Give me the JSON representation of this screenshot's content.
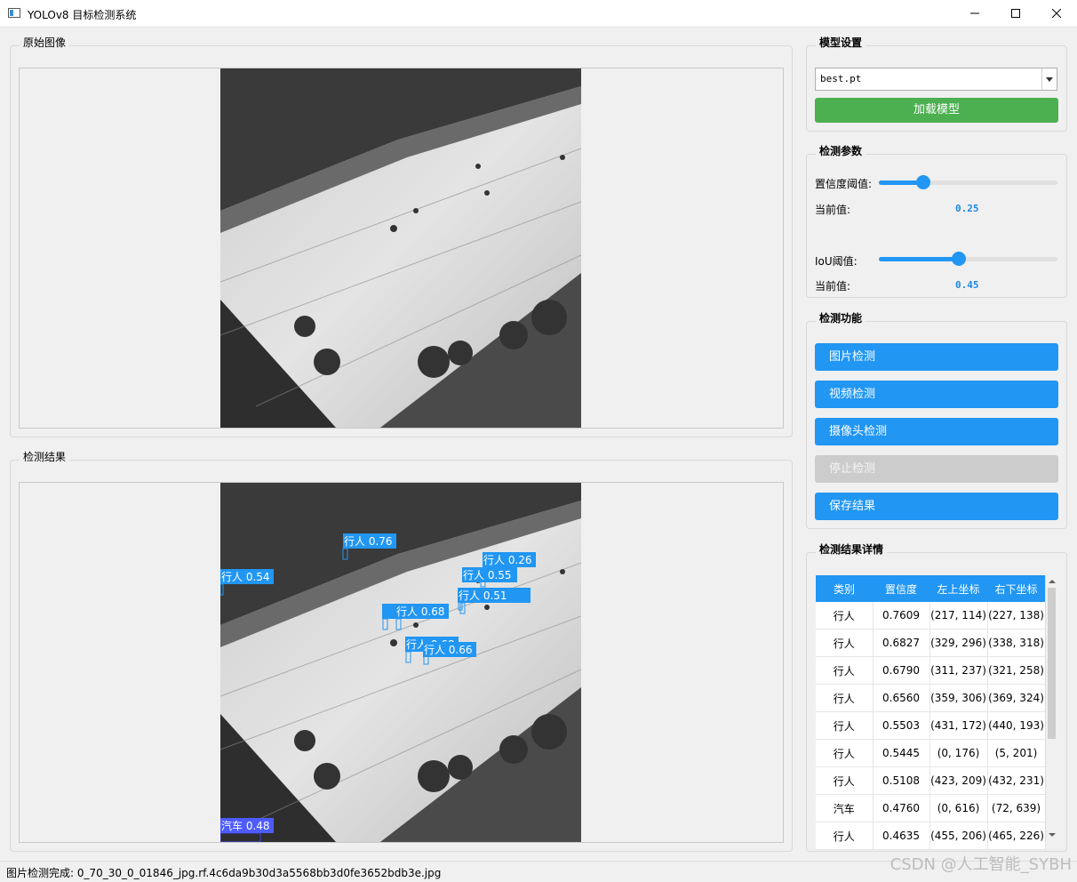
{
  "window": {
    "title": "YOLOv8 目标检测系统",
    "controls": [
      "minimize-icon",
      "maximize-icon",
      "close-icon"
    ]
  },
  "panels": {
    "original_title": "原始图像",
    "result_title": "检测结果"
  },
  "model_settings": {
    "title": "模型设置",
    "selected_model": "best.pt",
    "load_button": "加载模型"
  },
  "detection_params": {
    "title": "检测参数",
    "confidence_label": "置信度阈值:",
    "confidence_current_label": "当前值:",
    "confidence_value": "0.25",
    "confidence_fraction": 0.25,
    "iou_label": "IoU阈值:",
    "iou_current_label": "当前值:",
    "iou_value": "0.45",
    "iou_fraction": 0.45
  },
  "functions": {
    "title": "检测功能",
    "image_detect": "图片检测",
    "video_detect": "视频检测",
    "camera_detect": "摄像头检测",
    "stop_detect": "停止检测",
    "save_results": "保存结果"
  },
  "detections_overlay": [
    {
      "label": "行人 0.76"
    },
    {
      "label": "行人 0.54"
    },
    {
      "label": "行人 0.26"
    },
    {
      "label": "行人 0.55"
    },
    {
      "label": "行人 0.51"
    },
    {
      "label": "行人 0.68"
    },
    {
      "label": "行人 0.68"
    },
    {
      "label": "行人 0.66"
    },
    {
      "label": "汽车 0.48"
    }
  ],
  "results_detail": {
    "title": "检测结果详情",
    "headers": [
      "类别",
      "置信度",
      "左上坐标",
      "右下坐标"
    ],
    "rows": [
      [
        "行人",
        "0.7609",
        "(217, 114)",
        "(227, 138)"
      ],
      [
        "行人",
        "0.6827",
        "(329, 296)",
        "(338, 318)"
      ],
      [
        "行人",
        "0.6790",
        "(311, 237)",
        "(321, 258)"
      ],
      [
        "行人",
        "0.6560",
        "(359, 306)",
        "(369, 324)"
      ],
      [
        "行人",
        "0.5503",
        "(431, 172)",
        "(440, 193)"
      ],
      [
        "行人",
        "0.5445",
        "(0, 176)",
        "(5, 201)"
      ],
      [
        "行人",
        "0.5108",
        "(423, 209)",
        "(432, 231)"
      ],
      [
        "汽车",
        "0.4760",
        "(0, 616)",
        "(72, 639)"
      ],
      [
        "行人",
        "0.4635",
        "(455, 206)",
        "(465, 226)"
      ]
    ]
  },
  "status_bar": {
    "text": "图片检测完成: 0_70_30_0_01846_jpg.rf.4c6da9b30d3a5568bb3d0fe3652bdb3e.jpg"
  },
  "watermark": "CSDN @人工智能_SYBH"
}
